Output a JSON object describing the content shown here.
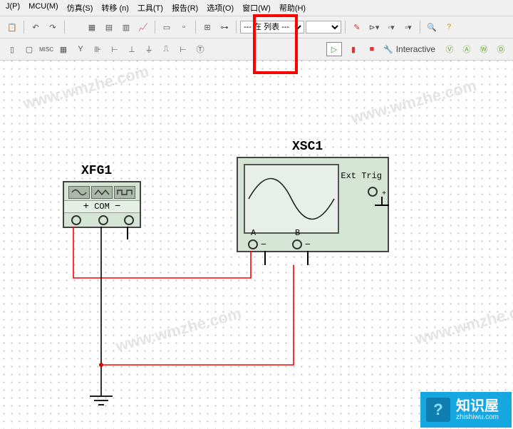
{
  "menu": {
    "p": "J(P)",
    "mcu": "MCU(M)",
    "sim": "仿真(S)",
    "transfer": "转移 (n)",
    "tools": "工具(T)",
    "report": "报告(R)",
    "options": "选项(O)",
    "window": "窗口(W)",
    "help": "帮助(H)"
  },
  "combo1": "--- 在 列表 ---",
  "sim_mode": "Interactive",
  "components": {
    "xfg": {
      "label": "XFG1",
      "com": "COM"
    },
    "xsc": {
      "label": "XSC1",
      "a": "A",
      "b": "B",
      "ext": "Ext Trig"
    }
  },
  "watermark": "www.wmzhe.com",
  "badge": {
    "title": "知识屋",
    "sub": "zhishiwu.com"
  }
}
